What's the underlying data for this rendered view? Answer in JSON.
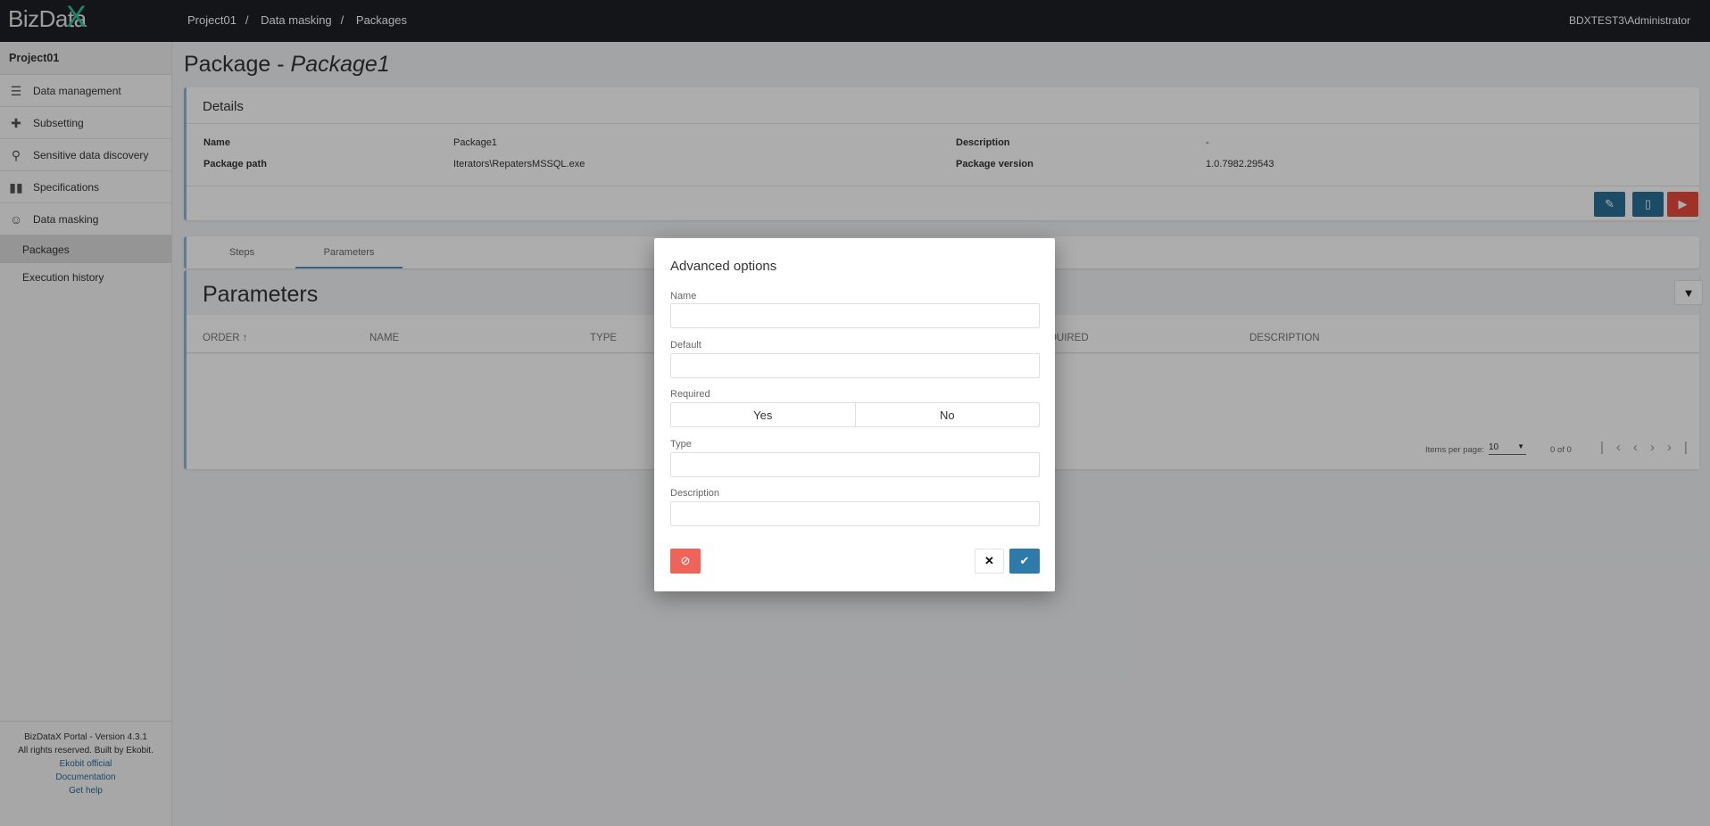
{
  "header": {
    "logo": "BizDataX",
    "breadcrumbs": [
      "Project01",
      "Data masking",
      "Packages"
    ],
    "separator": "/",
    "user": "BDXTEST3\\Administrator"
  },
  "sidebar": {
    "project": "Project01",
    "items": [
      {
        "label": "Data management",
        "icon": "database-icon"
      },
      {
        "label": "Subsetting",
        "icon": "puzzle-icon"
      },
      {
        "label": "Sensitive data discovery",
        "icon": "search-icon"
      },
      {
        "label": "Specifications",
        "icon": "book-icon"
      },
      {
        "label": "Data masking",
        "icon": "masks-icon"
      }
    ],
    "subitems": [
      {
        "label": "Packages",
        "active": true
      },
      {
        "label": "Execution history"
      }
    ],
    "footer": {
      "version": "BizDataX Portal - Version 4.3.1",
      "rights": "All rights reserved. Built by Ekobit.",
      "links": [
        "Ekobit official",
        "Documentation",
        "Get help"
      ]
    }
  },
  "page": {
    "title_prefix": "Package - ",
    "title_name": "Package1"
  },
  "details": {
    "title": "Details",
    "name_label": "Name",
    "name": "Package1",
    "path_label": "Package path",
    "path": "Iterators\\RepatersMSSQL.exe",
    "desc_label": "Description",
    "desc": "-",
    "version_label": "Package version",
    "version": "1.0.7982.29543"
  },
  "tabs": [
    {
      "label": "Steps"
    },
    {
      "label": "Parameters",
      "active": true
    }
  ],
  "parameters": {
    "title": "Parameters",
    "columns": [
      "ORDER",
      "NAME",
      "TYPE",
      "REQUIRED",
      "DESCRIPTION"
    ],
    "sort_icon": "↑",
    "items_per_page_label": "Items per page:",
    "items_per_page": "10",
    "range": "0 of 0"
  },
  "modal": {
    "title": "Advanced options",
    "name_label": "Name",
    "name_value": "",
    "default_label": "Default",
    "default_value": "",
    "required_label": "Required",
    "yes": "Yes",
    "no": "No",
    "type_label": "Type",
    "type_value": "",
    "description_label": "Description",
    "description_value": ""
  },
  "colors": {
    "primary": "#2a6f97",
    "danger": "#e74c3c",
    "modal_danger": "#ef6458",
    "accent": "#2fc49a"
  }
}
